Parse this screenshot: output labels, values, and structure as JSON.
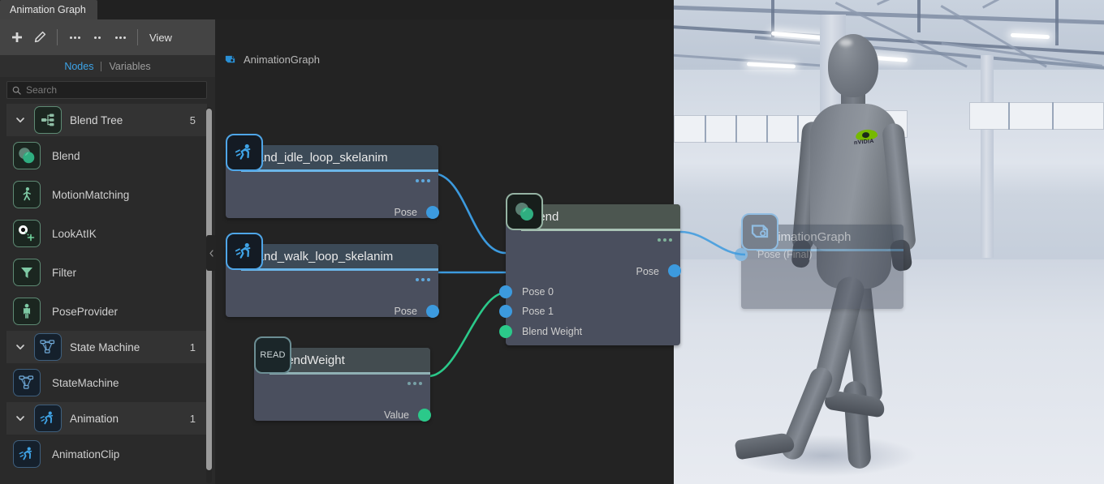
{
  "window": {
    "tabs": [
      {
        "label": "Animation Graph",
        "active": true
      }
    ]
  },
  "toolbar": {
    "add_label": "+",
    "edit_label": "edit",
    "menu1_label": "•••",
    "menu2_label": "••",
    "menu3_label": "•••",
    "view_label": "View"
  },
  "subtabs": [
    {
      "label": "Nodes",
      "active": true
    },
    {
      "label": "Variables",
      "active": false
    }
  ],
  "search": {
    "placeholder": "Search",
    "value": "",
    "icon": "search-icon"
  },
  "node_library": [
    {
      "type": "group",
      "label": "Blend Tree",
      "count": "5",
      "icon": "blend-tree-icon",
      "expanded": true,
      "items": [
        {
          "label": "Blend",
          "icon": "blend-circles-icon"
        },
        {
          "label": "MotionMatching",
          "icon": "runner-icon"
        },
        {
          "label": "LookAtIK",
          "icon": "eye-target-icon"
        },
        {
          "label": "Filter",
          "icon": "funnel-icon"
        },
        {
          "label": "PoseProvider",
          "icon": "figure-icon"
        }
      ]
    },
    {
      "type": "group",
      "label": "State Machine",
      "count": "1",
      "icon": "state-machine-icon",
      "expanded": true,
      "items": [
        {
          "label": "StateMachine",
          "icon": "state-machine-icon"
        }
      ]
    },
    {
      "type": "group",
      "label": "Animation",
      "count": "1",
      "icon": "runner-icon",
      "expanded": true,
      "items": [
        {
          "label": "AnimationClip",
          "icon": "runner-icon"
        }
      ]
    }
  ],
  "graph": {
    "breadcrumb": "AnimationGraph",
    "breadcrumb_icon": "animation-graph-icon",
    "nodes": [
      {
        "id": "stand_idle",
        "kind": "anim",
        "title": "stand_idle_loop_skelanim",
        "icon": "runner-icon",
        "menu": "node-menu-dots",
        "outputs": [
          {
            "label": "Pose",
            "color": "blue"
          }
        ],
        "inputs": []
      },
      {
        "id": "stand_walk",
        "kind": "anim",
        "title": "stand_walk_loop_skelanim",
        "icon": "runner-icon",
        "menu": "node-menu-dots",
        "outputs": [
          {
            "label": "Pose",
            "color": "blue"
          }
        ],
        "inputs": []
      },
      {
        "id": "blend",
        "kind": "blend",
        "title": "Blend",
        "icon": "blend-circles-icon",
        "menu": "node-menu-dots",
        "outputs": [
          {
            "label": "Pose",
            "color": "blue"
          }
        ],
        "inputs": [
          {
            "label": "Pose 0",
            "color": "blue"
          },
          {
            "label": "Pose 1",
            "color": "blue"
          },
          {
            "label": "Blend Weight",
            "color": "green"
          }
        ]
      },
      {
        "id": "blendweight",
        "kind": "readv",
        "title": "BlendWeight",
        "icon": "READ",
        "menu": "node-menu-dots",
        "outputs": [
          {
            "label": "Value",
            "color": "green"
          }
        ],
        "inputs": []
      },
      {
        "id": "final",
        "kind": "output",
        "title": "AnimationGraph",
        "icon": "animation-graph-icon",
        "inputs": [
          {
            "label": "Pose (Final)",
            "color": "blue"
          }
        ],
        "outputs": []
      }
    ],
    "connections": [
      {
        "from": "stand_idle.Pose",
        "to": "blend.Pose 0",
        "color": "blue"
      },
      {
        "from": "stand_walk.Pose",
        "to": "blend.Pose 1",
        "color": "blue"
      },
      {
        "from": "blendweight.Value",
        "to": "blend.Blend Weight",
        "color": "green"
      },
      {
        "from": "blend.Pose",
        "to": "final.Pose (Final)",
        "color": "blue"
      }
    ]
  },
  "viewport": {
    "character_logo": "nvidia-logo",
    "character_logo_text": "nVIDIA"
  },
  "colors": {
    "accent_blue": "#3da4e8",
    "port_blue": "#3c9ade",
    "port_green": "#2bc98a",
    "panel_bg": "#2a2a2a",
    "toolbar_bg": "#444444",
    "canvas_bg": "#232323",
    "node_body": "#4a4f5e",
    "nvidia_green": "#76b900"
  }
}
